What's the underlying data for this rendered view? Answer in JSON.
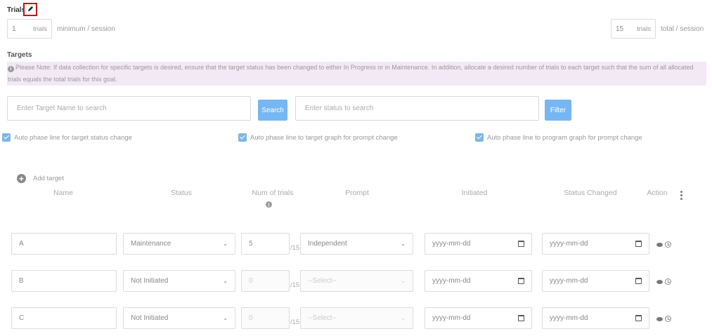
{
  "trials": {
    "title": "Trials",
    "min_value": "1",
    "min_unit": "trials",
    "min_suffix": "minimum / session",
    "total_value": "15",
    "total_unit": "trials",
    "total_suffix": "total / session"
  },
  "targets": {
    "title": "Targets",
    "note": "Please Note: If data collection for specific targets is desired, ensure that the target status has been changed to either In Progress or in Maintenance. In addition, allocate a desired number of trials to each target such that the sum of all allocated trials equals the total trials for this goal.",
    "search_placeholder": "Enter Target Name to search",
    "search_button": "Search",
    "status_placeholder": "Enter status to search",
    "filter_button": "Filter"
  },
  "checkboxes": [
    {
      "label": "Auto phase line for target status change",
      "checked": true
    },
    {
      "label": "Auto phase line to target graph for prompt change",
      "checked": true
    },
    {
      "label": "Auto phase line to program graph for prompt change",
      "checked": true
    }
  ],
  "table": {
    "add_target": "Add target",
    "headers": {
      "name": "Name",
      "status": "Status",
      "num_trials": "Num of trials",
      "prompt": "Prompt",
      "initiated": "Initiated",
      "status_changed": "Status Changed",
      "action": "Action"
    },
    "rows": [
      {
        "name": "A",
        "status": "Maintenance",
        "trials": "5",
        "of": "/15",
        "prompt": "Independent",
        "initiated": "yyyy-mm-dd",
        "status_changed": "yyyy-mm-dd"
      },
      {
        "name": "B",
        "status": "Not Initiated",
        "trials": "0",
        "of": "/15",
        "prompt": "--Select--",
        "initiated": "yyyy-mm-dd",
        "status_changed": "yyyy-mm-dd"
      },
      {
        "name": "C",
        "status": "Not Initiated",
        "trials": "0",
        "of": "/15",
        "prompt": "--Select--",
        "initiated": "yyyy-mm-dd",
        "status_changed": "yyyy-mm-dd"
      }
    ]
  },
  "icons": {
    "edit": "pencil-icon",
    "add": "plus-circle-icon",
    "info": "info-icon",
    "calendar": "calendar-icon",
    "view": "eye-icon",
    "history": "history-icon",
    "menu": "kebab-menu-icon",
    "dropdown": "chevron-down-icon"
  },
  "colors": {
    "accent": "#76b7f2",
    "note_bg": "#f3e9f6",
    "highlight_border": "#c0141b"
  }
}
